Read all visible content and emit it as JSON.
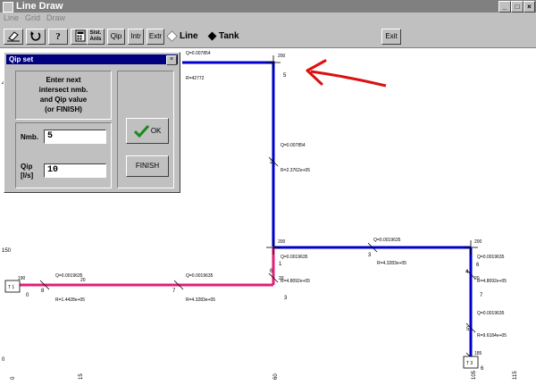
{
  "window": {
    "title": "Line Draw"
  },
  "menu": {
    "items": [
      "Line",
      "Grid",
      "Draw"
    ]
  },
  "toolbar": {
    "qip": "Qip",
    "intr": "Intr",
    "extr": "Extr",
    "sist_line1": "Sist.",
    "sist_line2": "Anls",
    "radio_line": "Line",
    "radio_tank": "Tank",
    "exit": "Exit"
  },
  "dialog": {
    "title": "Qip set",
    "close": "×",
    "prompt": "Enter next\nintersect nmb.\nand Qip value\n(or FINISH)",
    "nmb_label": "Nmb.",
    "nmb_value": "5",
    "qip_label": "Qip\n[l/s]",
    "qip_value": "10",
    "ok": "OK",
    "finish": "FINISH"
  },
  "canvas": {
    "left_labels": [
      "150",
      "0"
    ],
    "x_axis_labels": [
      "0",
      "15",
      "60",
      "105",
      "115"
    ],
    "tanks": [
      {
        "label": "T 1",
        "elev": "190"
      },
      {
        "label": "T 3",
        "elev": "185"
      }
    ],
    "node_elev": [
      "200",
      "200",
      "200"
    ],
    "node_numbers": [
      "4",
      "5",
      "2",
      "3",
      "4",
      "6",
      "7",
      "8",
      "7",
      "5",
      "6",
      "3",
      "1",
      "6",
      "0"
    ],
    "pipes": [
      {
        "id": "top",
        "q": "Q=0.007854",
        "r": "R=42772"
      },
      {
        "id": "vertical-upper",
        "q": "Q=0.007854",
        "r": "R=2.3762e+05"
      },
      {
        "id": "horizontal-right",
        "q": "Q=0.0019635",
        "r": "R=4.8092e+05"
      },
      {
        "id": "horizontal-right-2",
        "q": "Q=0.0019635",
        "r": "R=4.3283e+05"
      },
      {
        "id": "right-junction",
        "q": "Q=0.0019635",
        "r": "R=4.8092e+05"
      },
      {
        "id": "right-lower",
        "q": "Q=0.0019635",
        "r": "R=9.6184e+05"
      },
      {
        "id": "pink-left",
        "q": "Q=0.0019635",
        "r": "R=1.4428e+05"
      },
      {
        "id": "pink-mid",
        "q": "Q=0.0019635",
        "r": "R=4.3283e+05"
      }
    ],
    "stray_labels": [
      "20",
      "20",
      "20"
    ]
  },
  "colors": {
    "blue_pipe": "#0000cc",
    "pink_pipe": "#e0207a",
    "annotation_arrow": "#dd1010"
  }
}
